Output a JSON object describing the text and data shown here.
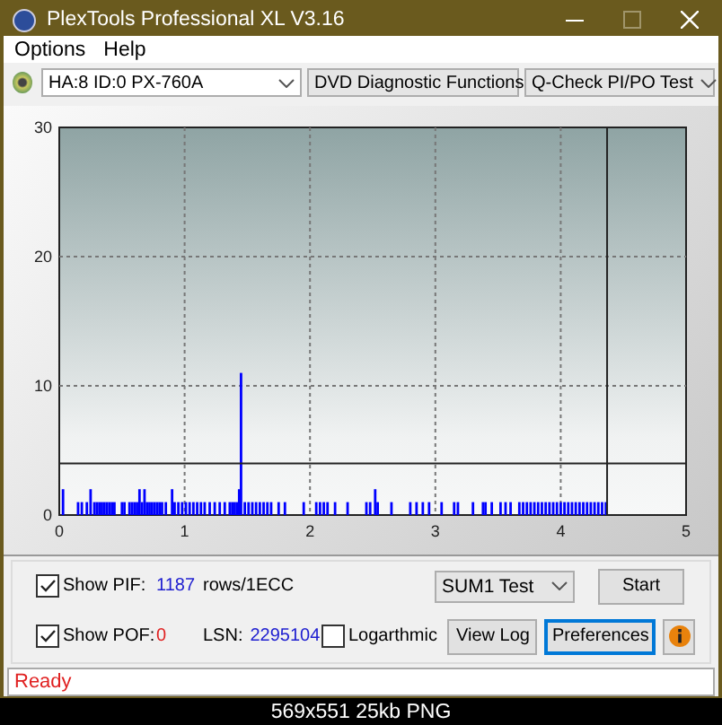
{
  "window": {
    "title": "PlexTools Professional XL V3.16"
  },
  "menu": [
    {
      "label": "Options"
    },
    {
      "label": "Help"
    }
  ],
  "toolbar": {
    "drive": "HA:8 ID:0  PX-760A",
    "function": "DVD Diagnostic Functions",
    "test": "Q-Check PI/PO Test"
  },
  "chart": {
    "chart_data": {
      "type": "bar",
      "xlim": [
        0,
        5
      ],
      "ylim": [
        0,
        30
      ],
      "xticks": [
        0,
        1,
        2,
        3,
        4,
        5
      ],
      "yticks": [
        0,
        10,
        20,
        30
      ],
      "x": [
        0.03,
        0.15,
        0.18,
        0.22,
        0.25,
        0.28,
        0.3,
        0.32,
        0.34,
        0.36,
        0.38,
        0.4,
        0.42,
        0.44,
        0.5,
        0.52,
        0.56,
        0.58,
        0.6,
        0.62,
        0.64,
        0.66,
        0.68,
        0.7,
        0.72,
        0.74,
        0.76,
        0.78,
        0.8,
        0.82,
        0.85,
        0.9,
        0.92,
        0.95,
        0.98,
        1.01,
        1.04,
        1.07,
        1.1,
        1.13,
        1.16,
        1.2,
        1.24,
        1.28,
        1.32,
        1.36,
        1.38,
        1.4,
        1.42,
        1.435,
        1.45,
        1.48,
        1.51,
        1.54,
        1.57,
        1.6,
        1.63,
        1.66,
        1.69,
        1.75,
        1.8,
        1.95,
        2.05,
        2.08,
        2.11,
        2.14,
        2.2,
        2.3,
        2.45,
        2.48,
        2.52,
        2.54,
        2.65,
        2.8,
        2.85,
        2.9,
        2.95,
        3.05,
        3.15,
        3.18,
        3.3,
        3.38,
        3.4,
        3.45,
        3.52,
        3.56,
        3.6,
        3.67,
        3.7,
        3.73,
        3.76,
        3.79,
        3.82,
        3.85,
        3.88,
        3.91,
        3.94,
        3.97,
        4.0,
        4.03,
        4.06,
        4.09,
        4.12,
        4.15,
        4.18,
        4.21,
        4.24,
        4.27,
        4.3,
        4.33,
        4.36
      ],
      "series": [
        {
          "color": "#0000ff",
          "values": [
            2,
            1,
            1,
            1,
            2,
            1,
            1,
            1,
            1,
            1,
            1,
            1,
            1,
            1,
            1,
            1,
            1,
            1,
            1,
            1,
            2,
            1,
            2,
            1,
            1,
            1,
            1,
            1,
            1,
            1,
            1,
            2,
            1,
            1,
            1,
            1,
            1,
            1,
            1,
            1,
            1,
            1,
            1,
            1,
            1,
            1,
            1,
            1,
            1,
            2,
            11,
            1,
            1,
            1,
            1,
            1,
            1,
            1,
            1,
            1,
            1,
            1,
            1,
            1,
            1,
            1,
            1,
            1,
            1,
            1,
            2,
            1,
            1,
            1,
            1,
            1,
            1,
            1,
            1,
            1,
            1,
            1,
            1,
            1,
            1,
            1,
            1,
            1,
            1,
            1,
            1,
            1,
            1,
            1,
            1,
            1,
            1,
            1,
            1,
            1,
            1,
            1,
            1,
            1,
            1,
            1,
            1,
            1,
            1,
            1,
            1
          ]
        }
      ],
      "grid": true,
      "ref_lines": [
        {
          "axis": "y",
          "value": 4
        },
        {
          "axis": "x",
          "value": 4.37
        }
      ]
    }
  },
  "controls": {
    "show_pif": {
      "label": "Show PIF:",
      "checked": true,
      "value": "1187"
    },
    "unit": "rows/1ECC",
    "test_select": "SUM1 Test",
    "start_button": "Start",
    "show_pof": {
      "label": "Show POF:",
      "checked": true,
      "value": "0"
    },
    "lsn_label": "LSN:",
    "lsn_value": "2295104",
    "logarithmic": {
      "label": "Logarthmic",
      "checked": false
    },
    "buttons": [
      {
        "label": "View Log",
        "selected": false
      },
      {
        "label": "Preferences",
        "selected": true
      }
    ]
  },
  "status_bar": "Ready",
  "caption": "569x551 25kb PNG"
}
